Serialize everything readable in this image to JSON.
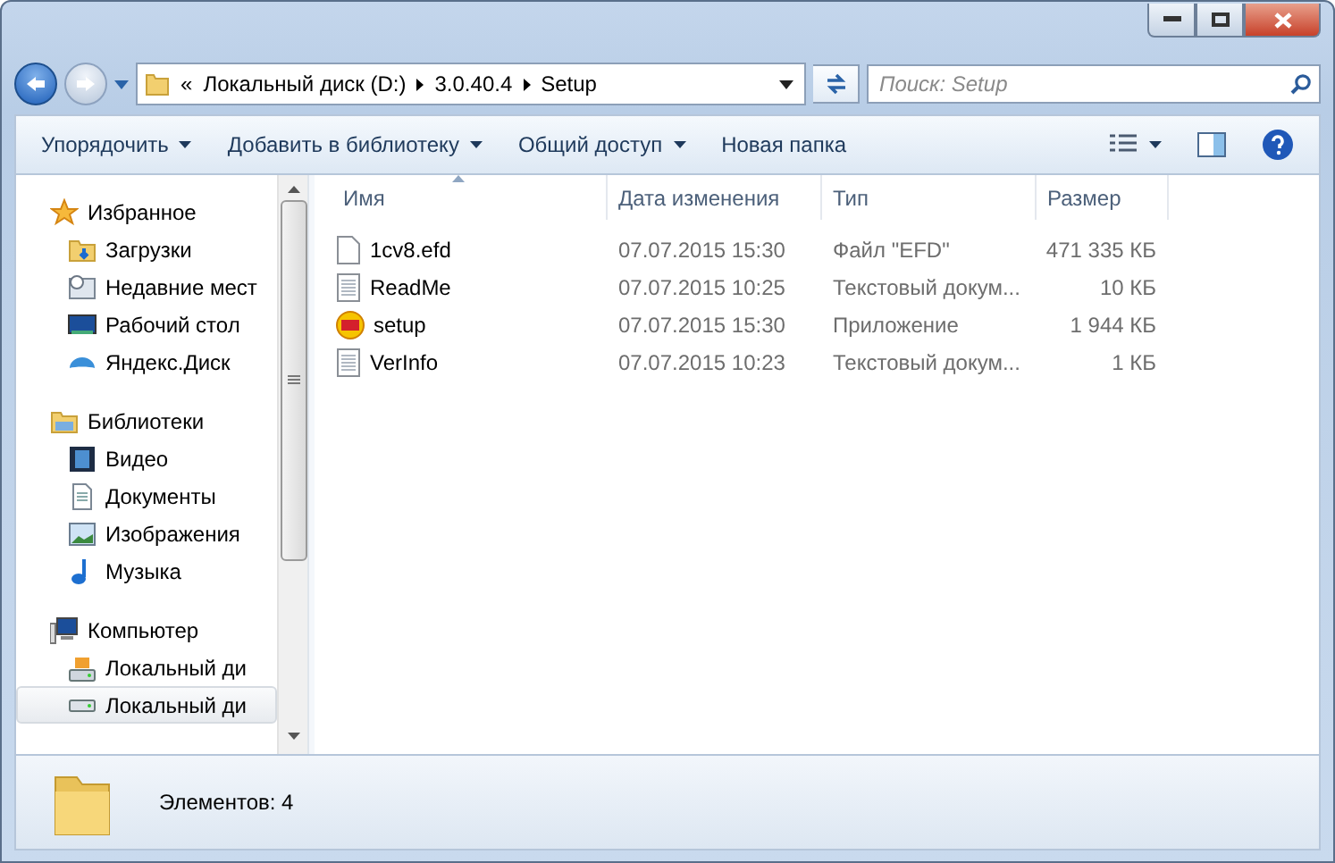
{
  "address": {
    "overflow": "«",
    "crumbs": [
      "Локальный диск (D:)",
      "3.0.40.4",
      "Setup"
    ]
  },
  "search": {
    "placeholder": "Поиск: Setup"
  },
  "toolbar": {
    "items": [
      {
        "label": "Упорядочить",
        "dropdown": true
      },
      {
        "label": "Добавить в библиотеку",
        "dropdown": true
      },
      {
        "label": "Общий доступ",
        "dropdown": true
      },
      {
        "label": "Новая папка",
        "dropdown": false
      }
    ]
  },
  "sidebar": {
    "groups": [
      {
        "label": "Избранное",
        "children": [
          {
            "label": "Загрузки",
            "selected": false
          },
          {
            "label": "Недавние мест",
            "selected": false
          },
          {
            "label": "Рабочий стол",
            "selected": false
          },
          {
            "label": "Яндекс.Диск",
            "selected": false
          }
        ]
      },
      {
        "label": "Библиотеки",
        "children": [
          {
            "label": "Видео",
            "selected": false
          },
          {
            "label": "Документы",
            "selected": false
          },
          {
            "label": "Изображения",
            "selected": false
          },
          {
            "label": "Музыка",
            "selected": false
          }
        ]
      },
      {
        "label": "Компьютер",
        "children": [
          {
            "label": "Локальный ди",
            "selected": false
          },
          {
            "label": "Локальный ди",
            "selected": true
          }
        ]
      }
    ]
  },
  "table": {
    "columns": [
      {
        "label": "Имя",
        "sorted": true
      },
      {
        "label": "Дата изменения",
        "sorted": false
      },
      {
        "label": "Тип",
        "sorted": false
      },
      {
        "label": "Размер",
        "sorted": false
      }
    ],
    "rows": [
      {
        "kind": "file",
        "name": "1cv8.efd",
        "date": "07.07.2015 15:30",
        "type": "Файл \"EFD\"",
        "size": "471 335 КБ"
      },
      {
        "kind": "text",
        "name": "ReadMe",
        "date": "07.07.2015 10:25",
        "type": "Текстовый докум...",
        "size": "10 КБ"
      },
      {
        "kind": "app",
        "name": "setup",
        "date": "07.07.2015 15:30",
        "type": "Приложение",
        "size": "1 944 КБ"
      },
      {
        "kind": "text",
        "name": "VerInfo",
        "date": "07.07.2015 10:23",
        "type": "Текстовый докум...",
        "size": "1 КБ"
      }
    ]
  },
  "status_bar": {
    "text": "Элементов: 4"
  }
}
